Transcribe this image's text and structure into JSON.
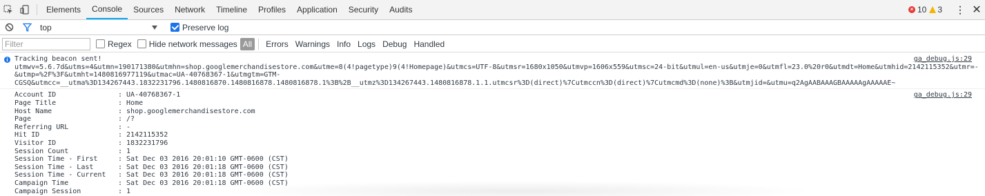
{
  "tabs": [
    "Elements",
    "Console",
    "Sources",
    "Network",
    "Timeline",
    "Profiles",
    "Application",
    "Security",
    "Audits"
  ],
  "active_tab": "Console",
  "status": {
    "errors": "10",
    "warnings": "3"
  },
  "context": {
    "value": "top",
    "preserve_log_label": "Preserve log",
    "preserve_log": true
  },
  "filter": {
    "placeholder": "Filter",
    "regex_label": "Regex",
    "hide_network_label": "Hide network messages",
    "levels": [
      "All",
      "Errors",
      "Warnings",
      "Info",
      "Logs",
      "Debug",
      "Handled"
    ]
  },
  "messages": {
    "m1": {
      "source": "ga_debug.js:29",
      "lines": [
        "Tracking beacon sent!",
        "utmwv=5.6.7d&utms=4&utmn=190171380&utmhn=shop.googlemerchandisestore.com&utme=8(4!pagetype)9(4!Homepage)&utmcs=UTF-8&utmsr=1680x1050&utmvp=1606x559&utmsc=24-bit&utmul=en-us&utmje=0&utmfl=23.0%20r0&utmdt=Home&utmhid=2142115352&utmr=-",
        "&utmp=%2F%3F&utmht=1480816977119&utmac=UA-40768367-1&utmgtm=GTM-",
        "CGSQ&utmcc=__utma%3D134267443.1832231796.1480816870.1480816878.1480816878.1%3B%2B__utmz%3D134267443.1480816878.1.1.utmcsr%3D(direct)%7Cutmccn%3D(direct)%7Cutmcmd%3D(none)%3B&utmjid=&utmu=q2AgAABAAAGBAAAAAgAAAAAE~"
      ]
    },
    "m2": {
      "source": "ga_debug.js:29",
      "rows": [
        {
          "key": "Account ID",
          "value": ": UA-40768367-1"
        },
        {
          "key": "Page Title",
          "value": ": Home"
        },
        {
          "key": "Host Name",
          "value": ": shop.googlemerchandisestore.com"
        },
        {
          "key": "Page",
          "value": ": /?"
        },
        {
          "key": "Referring URL",
          "value": ": -"
        },
        {
          "key": "Hit ID",
          "value": ": 2142115352"
        },
        {
          "key": "Visitor ID",
          "value": ": 1832231796"
        },
        {
          "key": "Session Count",
          "value": ": 1"
        },
        {
          "key": "Session Time - First",
          "value": ": Sat Dec 03 2016 20:01:10 GMT-0600 (CST)"
        },
        {
          "key": "Session Time - Last",
          "value": ": Sat Dec 03 2016 20:01:18 GMT-0600 (CST)"
        },
        {
          "key": "Session Time - Current",
          "value": ": Sat Dec 03 2016 20:01:18 GMT-0600 (CST)"
        },
        {
          "key": "Campaign Time",
          "value": ": Sat Dec 03 2016 20:01:18 GMT-0600 (CST)"
        },
        {
          "key": "Campaign Session",
          "value": ": 1"
        }
      ]
    }
  }
}
